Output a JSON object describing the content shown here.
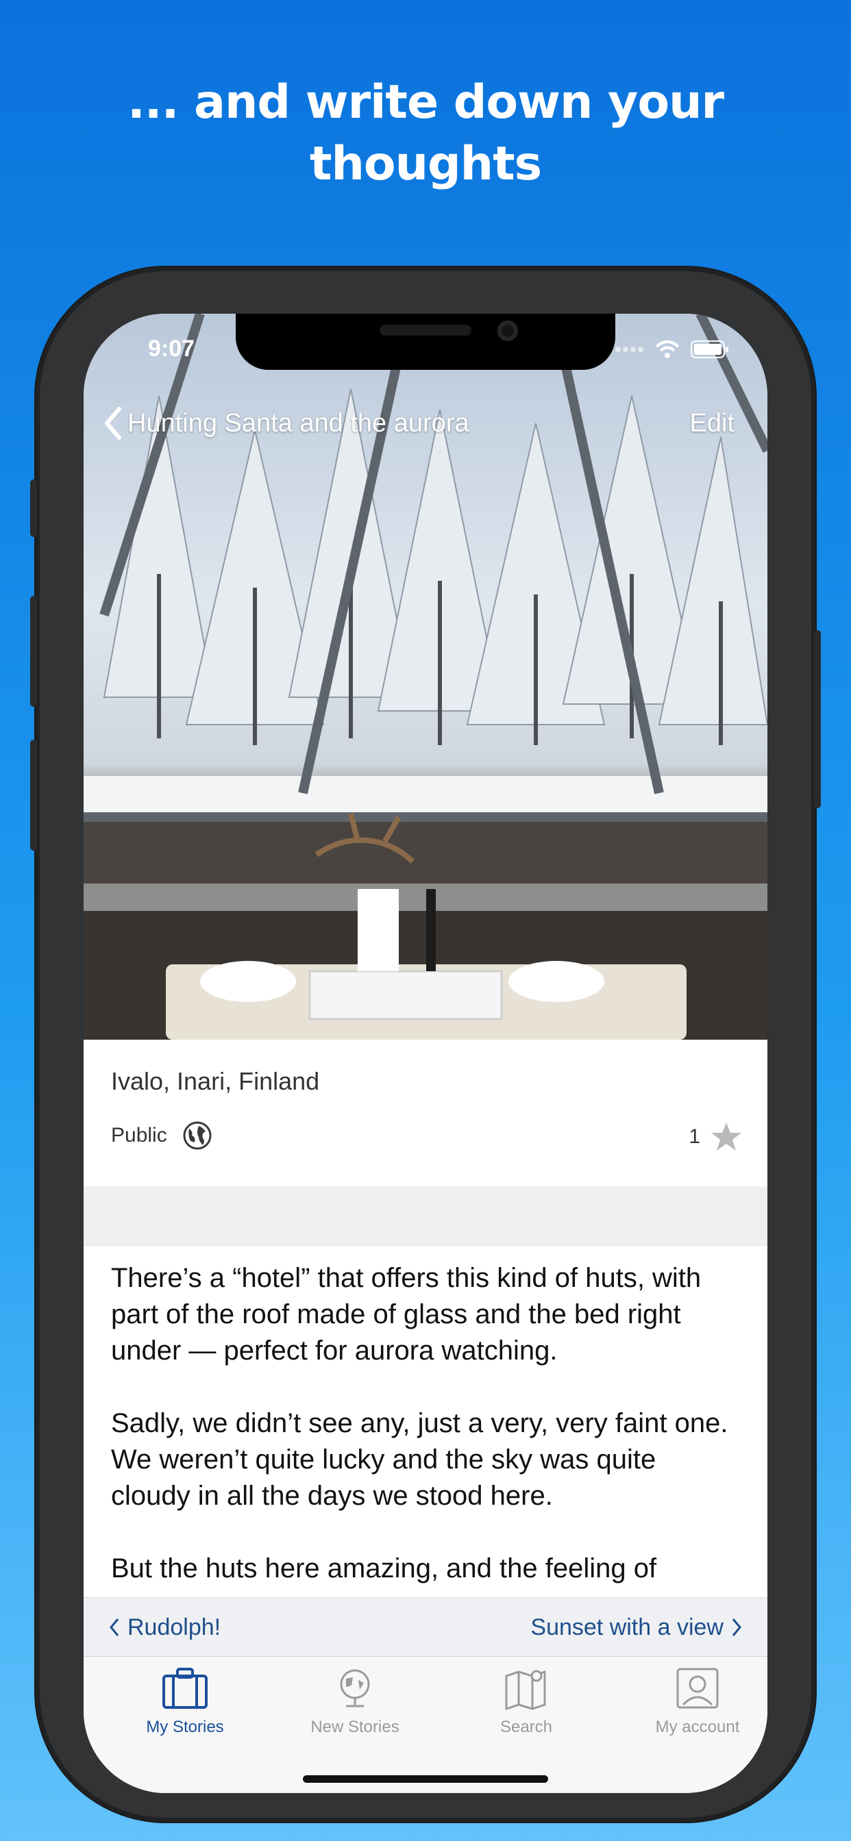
{
  "headline": {
    "line1": "... and write down your",
    "line2": "thoughts"
  },
  "status_bar": {
    "time": "9:07"
  },
  "navbar": {
    "back_label": "Hunting Santa and the aurora",
    "edit_label": "Edit"
  },
  "story": {
    "location": "Ivalo, Inari, Finland",
    "visibility": "Public",
    "star_count": "1",
    "paragraphs": [
      "There’s a “hotel” that offers this kind of huts, with part of the roof made of glass and the bed right under — perfect for aurora watching.",
      "Sadly, we didn’t see any, just a very, very faint one. We weren’t quite lucky and the sky was quite cloudy in all the days we stood here.",
      "But the huts here amazing, and the feeling of"
    ]
  },
  "pager": {
    "prev": "Rudolph!",
    "next": "Sunset with a view"
  },
  "tabs": [
    {
      "label": "My Stories",
      "icon": "suitcase-icon",
      "active": true
    },
    {
      "label": "New Stories",
      "icon": "globe-icon",
      "active": false
    },
    {
      "label": "Search",
      "icon": "map-icon",
      "active": false
    },
    {
      "label": "My account",
      "icon": "user-icon",
      "active": false
    }
  ],
  "colors": {
    "background_top": "#0a72dc",
    "background_bottom": "#62c2fb",
    "accent": "#1a4f9c",
    "link": "#1f4e8c"
  }
}
